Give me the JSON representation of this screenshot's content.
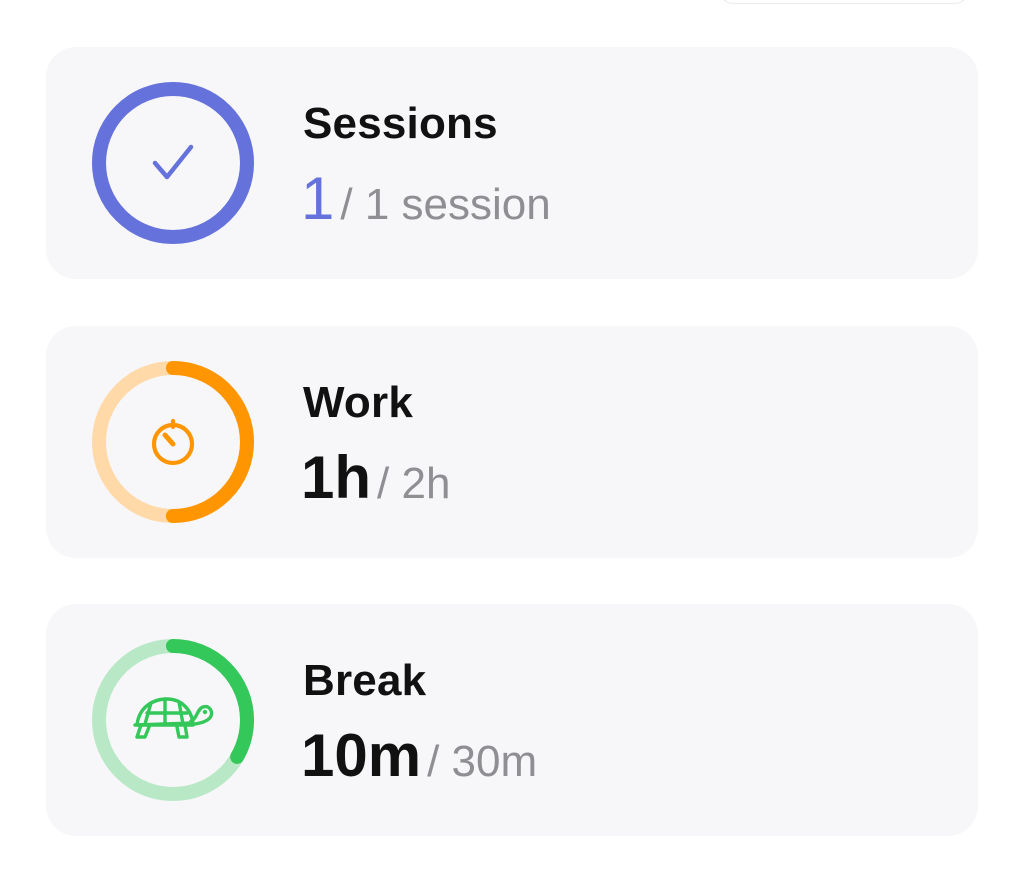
{
  "cards": [
    {
      "id": "sessions",
      "title": "Sessions",
      "value": "1",
      "goal": "/ 1 session",
      "progress": 1.0,
      "icon": "checkmark-icon",
      "color": "#6672db",
      "track_color": "#c9cdf4"
    },
    {
      "id": "work",
      "title": "Work",
      "value": "1h",
      "goal": "/ 2h",
      "progress": 0.5,
      "icon": "timer-icon",
      "color": "#ff9500",
      "track_color": "#ffd9a8"
    },
    {
      "id": "break",
      "title": "Break",
      "value": "10m",
      "goal": "/ 30m",
      "progress": 0.333,
      "icon": "turtle-icon",
      "color": "#34c759",
      "track_color": "#b8e8c5"
    }
  ]
}
